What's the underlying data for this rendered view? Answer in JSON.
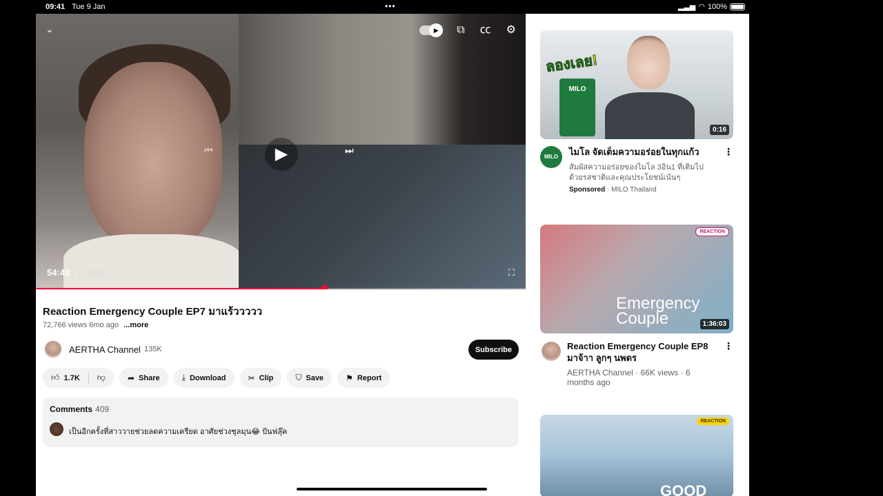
{
  "status_bar": {
    "time": "09:41",
    "date": "Tue 9 Jan",
    "dots": "•••",
    "battery": "100%"
  },
  "player": {
    "current_time": "54:43",
    "total_time": "/ 1:32:56",
    "progress_fraction": 0.589,
    "icons": [
      "chevron-down-icon",
      "autoplay-toggle",
      "cast-icon",
      "captions-icon",
      "settings-icon",
      "previous-icon",
      "play-icon",
      "next-icon",
      "fullscreen-icon"
    ],
    "accent_color": "#ff0033"
  },
  "video": {
    "title": "Reaction Emergency Couple EP7 มาแร้ววววว",
    "views": "72,766 views",
    "age": "6mo ago",
    "more_label": "...more"
  },
  "channel": {
    "name": "AERTHA Channel",
    "subscribers": "135K",
    "subscribe_label": "Subscribe"
  },
  "actions": {
    "likes": "1.7K",
    "share": "Share",
    "download": "Download",
    "clip": "Clip",
    "save": "Save",
    "report": "Report"
  },
  "comments": {
    "label": "Comments",
    "count": "409",
    "top_comment": "เป็นอีกครั้งที่สาววายช่วยลดความเครียด อาศัยช่วงชุลมุน😂 ปันฟลุ๊ค"
  },
  "sidebar": {
    "ad": {
      "promo_text": "ลองเลย!",
      "product_label": "MILO",
      "duration": "0:16",
      "logo_text": "MILO",
      "title": "ไมโล จัดเต็มความอร่อยในทุกแก้ว",
      "description": "สัมผัสความอร่อยของไมโล 3อิน1 ที่เติมไป ด้วยรสชาติและคุณประโยชน์เน้นๆ",
      "sponsored": "Sponsored",
      "advertiser": "· MILO Thailand"
    },
    "video_2": {
      "badge": "REACTION",
      "overlay_line1": "Emergency",
      "overlay_line2": "Couple",
      "duration": "1:36:03",
      "title": "Reaction Emergency Couple EP8 มาจ้าา ลูกๆ นพดร",
      "meta": "AERTHA Channel · 66K views · 6 months ago"
    },
    "video_3": {
      "badge": "REACTION",
      "overlay": "GOOD"
    }
  }
}
